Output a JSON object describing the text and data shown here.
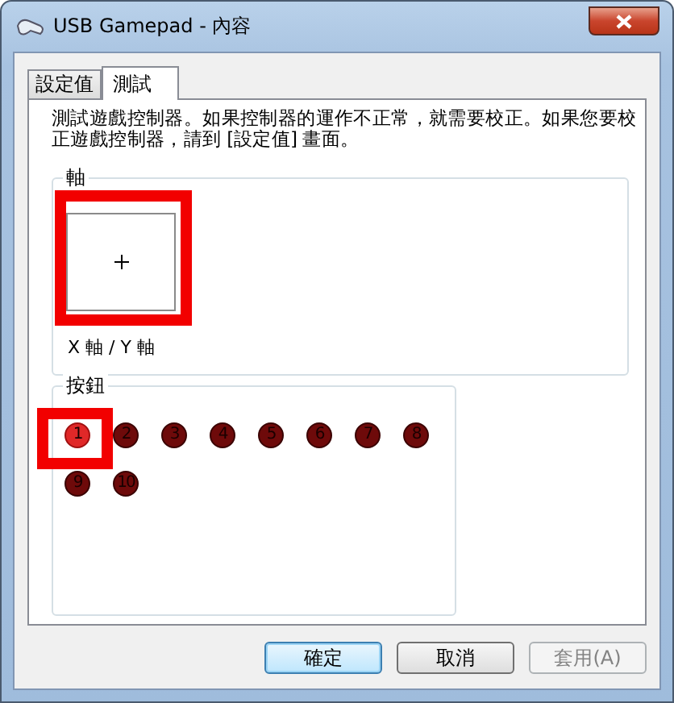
{
  "window": {
    "title": "USB Gamepad - 內容"
  },
  "tabs": [
    {
      "label": "設定值",
      "selected": false
    },
    {
      "label": "測試",
      "selected": true
    }
  ],
  "description": "測試遊戲控制器。如果控制器的運作不正常，就需要校正。如果您要校正遊戲控制器，請到 [設定值] 畫面。",
  "axes": {
    "title": "軸",
    "label": "X 軸 / Y 軸",
    "highlighted": true
  },
  "buttons_group": {
    "title": "按鈕",
    "buttons": [
      {
        "label": "1",
        "pressed": true,
        "highlighted": true
      },
      {
        "label": "2",
        "pressed": false,
        "highlighted": false
      },
      {
        "label": "3",
        "pressed": false,
        "highlighted": false
      },
      {
        "label": "4",
        "pressed": false,
        "highlighted": false
      },
      {
        "label": "5",
        "pressed": false,
        "highlighted": false
      },
      {
        "label": "6",
        "pressed": false,
        "highlighted": false
      },
      {
        "label": "7",
        "pressed": false,
        "highlighted": false
      },
      {
        "label": "8",
        "pressed": false,
        "highlighted": false
      },
      {
        "label": "9",
        "pressed": false,
        "highlighted": false
      },
      {
        "label": "10",
        "pressed": false,
        "highlighted": false
      }
    ]
  },
  "dialog_buttons": [
    {
      "label": "確定",
      "default": true,
      "disabled": false
    },
    {
      "label": "取消",
      "default": false,
      "disabled": false
    },
    {
      "label": "套用(A)",
      "default": false,
      "disabled": true
    }
  ]
}
